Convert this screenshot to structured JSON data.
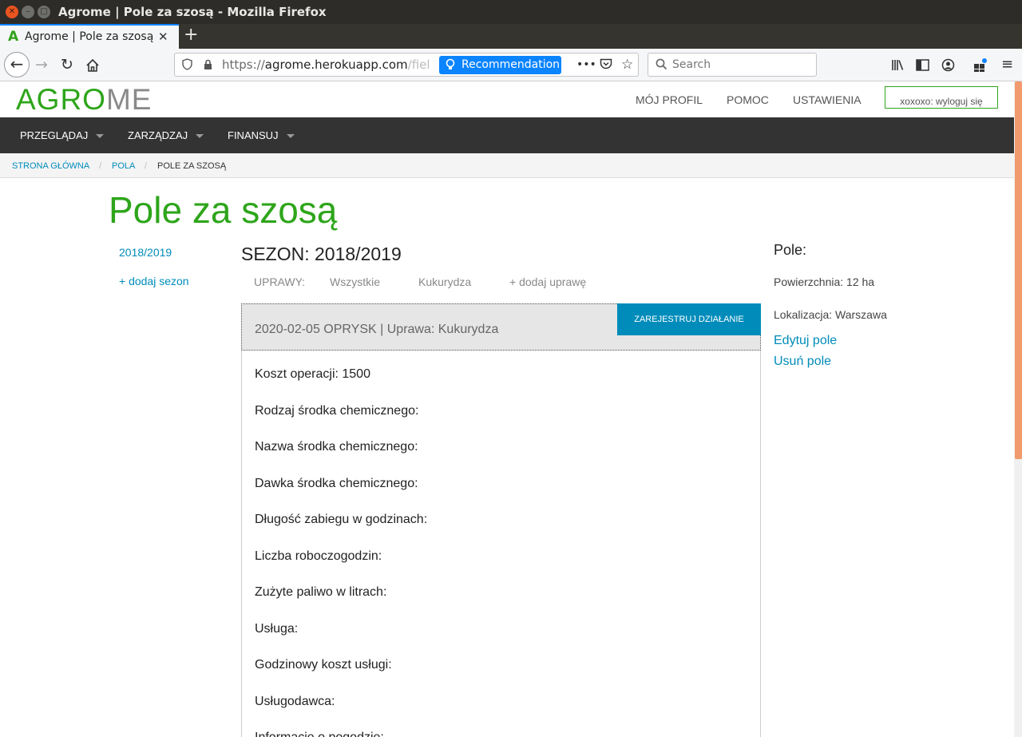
{
  "window": {
    "title": "Agrome | Pole za szosą - Mozilla Firefox"
  },
  "browser": {
    "tab_title": "Agrome | Pole za szosą",
    "tab_favicon": "A",
    "url_prefix": "https://",
    "url_host": "agrome.herokuapp.com",
    "url_path": "/fiel",
    "recommendation_label": "Recommendation",
    "search_placeholder": "Search"
  },
  "site": {
    "logo_green": "AGRO",
    "logo_gray": "ME",
    "top_links": [
      "MÓJ PROFIL",
      "POMOC",
      "USTAWIENIA"
    ],
    "logout_label": "xoxoxo: wyloguj się",
    "main_nav": [
      "PRZEGLĄDAJ",
      "ZARZĄDZAJ",
      "FINANSUJ"
    ],
    "breadcrumb": [
      "STRONA GŁÓWNA",
      "POLA",
      "POLE ZA SZOSĄ"
    ],
    "brand_color": "#2ea51b",
    "link_color": "#008cba"
  },
  "page": {
    "title": "Pole za szosą",
    "seasons_sidebar": [
      "2018/2019"
    ],
    "add_season_label": "+ dodaj sezon",
    "season_heading": "SEZON: 2018/2019",
    "crops_label": "UPRAWY:",
    "crops": [
      "Wszystkie",
      "Kukurydza"
    ],
    "add_crop_label": "+ dodaj uprawę",
    "action_button": "ZAREJESTRUJ DZIAŁANIE",
    "activity_title": "2020-02-05 OPRYSK | Uprawa: Kukurydza",
    "activity_fields": [
      "Koszt operacji: 1500",
      "Rodzaj środka chemicznego:",
      "Nazwa środka chemicznego:",
      "Dawka środka chemicznego:",
      "Długość zabiegu w godzinach:",
      "Liczba roboczogodzin:",
      "Zużyte paliwo w litrach:",
      "Usługa:",
      "Godzinowy koszt usługi:",
      "Usługodawca:",
      "Informacje o pogodzie:"
    ]
  },
  "field_info": {
    "heading": "Pole:",
    "area": "Powierzchnia: 12 ha",
    "location": "Lokalizacja: Warszawa",
    "edit_label": "Edytuj pole",
    "delete_label": "Usuń pole"
  }
}
